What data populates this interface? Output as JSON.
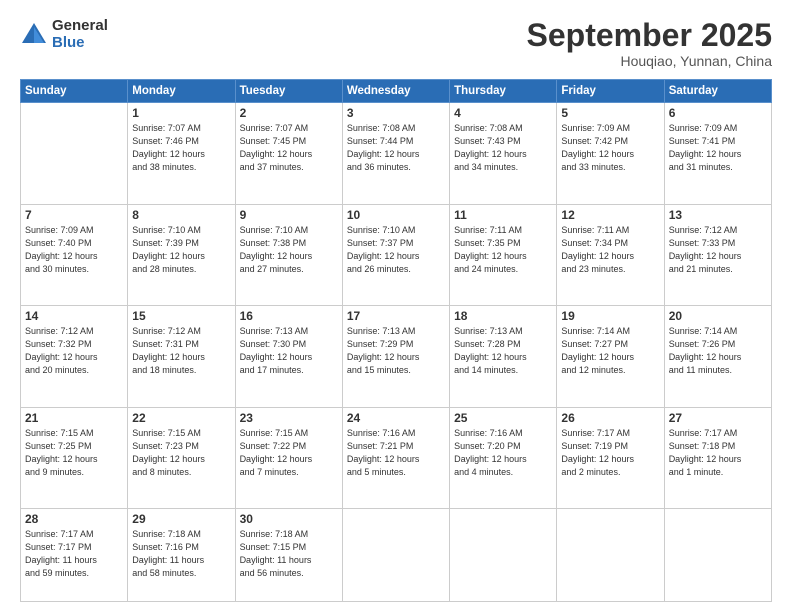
{
  "header": {
    "logo_general": "General",
    "logo_blue": "Blue",
    "month_title": "September 2025",
    "location": "Houqiao, Yunnan, China"
  },
  "weekdays": [
    "Sunday",
    "Monday",
    "Tuesday",
    "Wednesday",
    "Thursday",
    "Friday",
    "Saturday"
  ],
  "weeks": [
    [
      {
        "day": "",
        "info": ""
      },
      {
        "day": "1",
        "info": "Sunrise: 7:07 AM\nSunset: 7:46 PM\nDaylight: 12 hours\nand 38 minutes."
      },
      {
        "day": "2",
        "info": "Sunrise: 7:07 AM\nSunset: 7:45 PM\nDaylight: 12 hours\nand 37 minutes."
      },
      {
        "day": "3",
        "info": "Sunrise: 7:08 AM\nSunset: 7:44 PM\nDaylight: 12 hours\nand 36 minutes."
      },
      {
        "day": "4",
        "info": "Sunrise: 7:08 AM\nSunset: 7:43 PM\nDaylight: 12 hours\nand 34 minutes."
      },
      {
        "day": "5",
        "info": "Sunrise: 7:09 AM\nSunset: 7:42 PM\nDaylight: 12 hours\nand 33 minutes."
      },
      {
        "day": "6",
        "info": "Sunrise: 7:09 AM\nSunset: 7:41 PM\nDaylight: 12 hours\nand 31 minutes."
      }
    ],
    [
      {
        "day": "7",
        "info": "Sunrise: 7:09 AM\nSunset: 7:40 PM\nDaylight: 12 hours\nand 30 minutes."
      },
      {
        "day": "8",
        "info": "Sunrise: 7:10 AM\nSunset: 7:39 PM\nDaylight: 12 hours\nand 28 minutes."
      },
      {
        "day": "9",
        "info": "Sunrise: 7:10 AM\nSunset: 7:38 PM\nDaylight: 12 hours\nand 27 minutes."
      },
      {
        "day": "10",
        "info": "Sunrise: 7:10 AM\nSunset: 7:37 PM\nDaylight: 12 hours\nand 26 minutes."
      },
      {
        "day": "11",
        "info": "Sunrise: 7:11 AM\nSunset: 7:35 PM\nDaylight: 12 hours\nand 24 minutes."
      },
      {
        "day": "12",
        "info": "Sunrise: 7:11 AM\nSunset: 7:34 PM\nDaylight: 12 hours\nand 23 minutes."
      },
      {
        "day": "13",
        "info": "Sunrise: 7:12 AM\nSunset: 7:33 PM\nDaylight: 12 hours\nand 21 minutes."
      }
    ],
    [
      {
        "day": "14",
        "info": "Sunrise: 7:12 AM\nSunset: 7:32 PM\nDaylight: 12 hours\nand 20 minutes."
      },
      {
        "day": "15",
        "info": "Sunrise: 7:12 AM\nSunset: 7:31 PM\nDaylight: 12 hours\nand 18 minutes."
      },
      {
        "day": "16",
        "info": "Sunrise: 7:13 AM\nSunset: 7:30 PM\nDaylight: 12 hours\nand 17 minutes."
      },
      {
        "day": "17",
        "info": "Sunrise: 7:13 AM\nSunset: 7:29 PM\nDaylight: 12 hours\nand 15 minutes."
      },
      {
        "day": "18",
        "info": "Sunrise: 7:13 AM\nSunset: 7:28 PM\nDaylight: 12 hours\nand 14 minutes."
      },
      {
        "day": "19",
        "info": "Sunrise: 7:14 AM\nSunset: 7:27 PM\nDaylight: 12 hours\nand 12 minutes."
      },
      {
        "day": "20",
        "info": "Sunrise: 7:14 AM\nSunset: 7:26 PM\nDaylight: 12 hours\nand 11 minutes."
      }
    ],
    [
      {
        "day": "21",
        "info": "Sunrise: 7:15 AM\nSunset: 7:25 PM\nDaylight: 12 hours\nand 9 minutes."
      },
      {
        "day": "22",
        "info": "Sunrise: 7:15 AM\nSunset: 7:23 PM\nDaylight: 12 hours\nand 8 minutes."
      },
      {
        "day": "23",
        "info": "Sunrise: 7:15 AM\nSunset: 7:22 PM\nDaylight: 12 hours\nand 7 minutes."
      },
      {
        "day": "24",
        "info": "Sunrise: 7:16 AM\nSunset: 7:21 PM\nDaylight: 12 hours\nand 5 minutes."
      },
      {
        "day": "25",
        "info": "Sunrise: 7:16 AM\nSunset: 7:20 PM\nDaylight: 12 hours\nand 4 minutes."
      },
      {
        "day": "26",
        "info": "Sunrise: 7:17 AM\nSunset: 7:19 PM\nDaylight: 12 hours\nand 2 minutes."
      },
      {
        "day": "27",
        "info": "Sunrise: 7:17 AM\nSunset: 7:18 PM\nDaylight: 12 hours\nand 1 minute."
      }
    ],
    [
      {
        "day": "28",
        "info": "Sunrise: 7:17 AM\nSunset: 7:17 PM\nDaylight: 11 hours\nand 59 minutes."
      },
      {
        "day": "29",
        "info": "Sunrise: 7:18 AM\nSunset: 7:16 PM\nDaylight: 11 hours\nand 58 minutes."
      },
      {
        "day": "30",
        "info": "Sunrise: 7:18 AM\nSunset: 7:15 PM\nDaylight: 11 hours\nand 56 minutes."
      },
      {
        "day": "",
        "info": ""
      },
      {
        "day": "",
        "info": ""
      },
      {
        "day": "",
        "info": ""
      },
      {
        "day": "",
        "info": ""
      }
    ]
  ]
}
